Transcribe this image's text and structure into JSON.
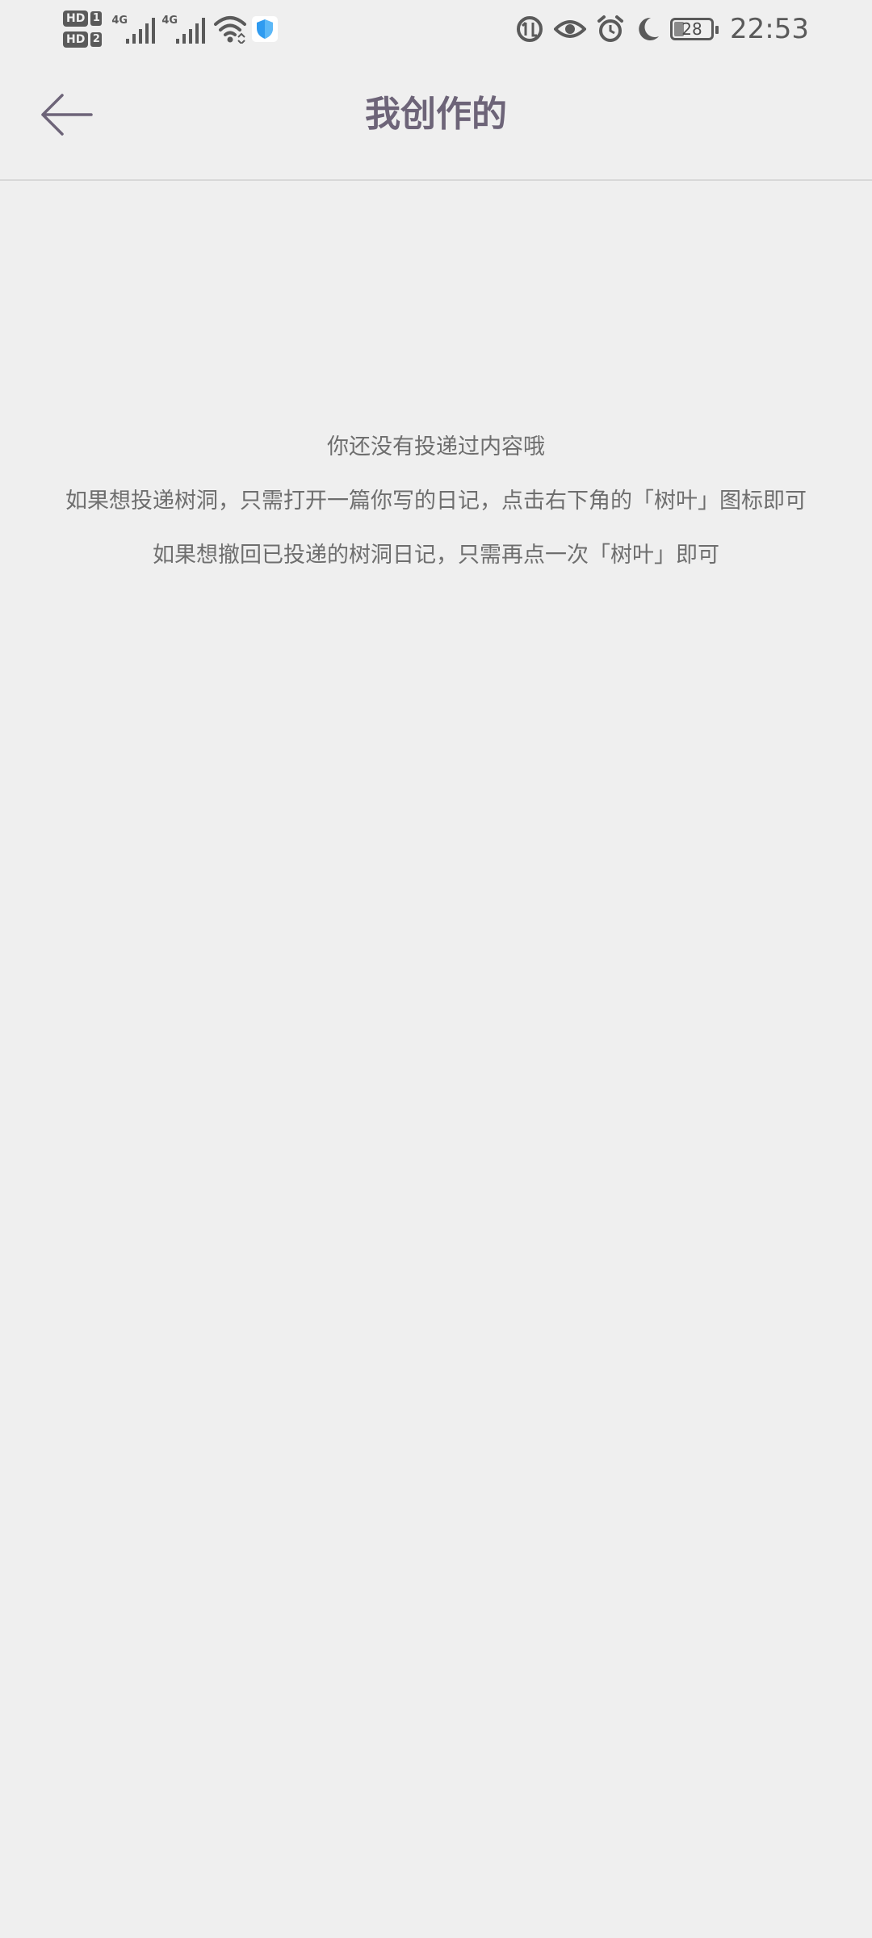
{
  "status_bar": {
    "sim1_label": "HD",
    "sim1_number": "1",
    "sim2_label": "HD",
    "sim2_number": "2",
    "network1": "4G",
    "network2": "4G",
    "battery_level": "28",
    "time": "22:53",
    "icons": [
      "hd-icon",
      "signal-icon",
      "wifi-icon",
      "shield-icon",
      "data-saver-icon",
      "eye-comfort-icon",
      "alarm-icon",
      "moon-icon",
      "battery-icon"
    ]
  },
  "header": {
    "title": "我创作的",
    "back_icon": "back-arrow-icon",
    "accent_color": "#6d6478"
  },
  "empty_state": {
    "line1": "你还没有投递过内容哦",
    "line2": "如果想投递树洞，只需打开一篇你写的日记，点击右下角的「树叶」图标即可",
    "line3": "如果想撤回已投递的树洞日记，只需再点一次「树叶」即可"
  }
}
